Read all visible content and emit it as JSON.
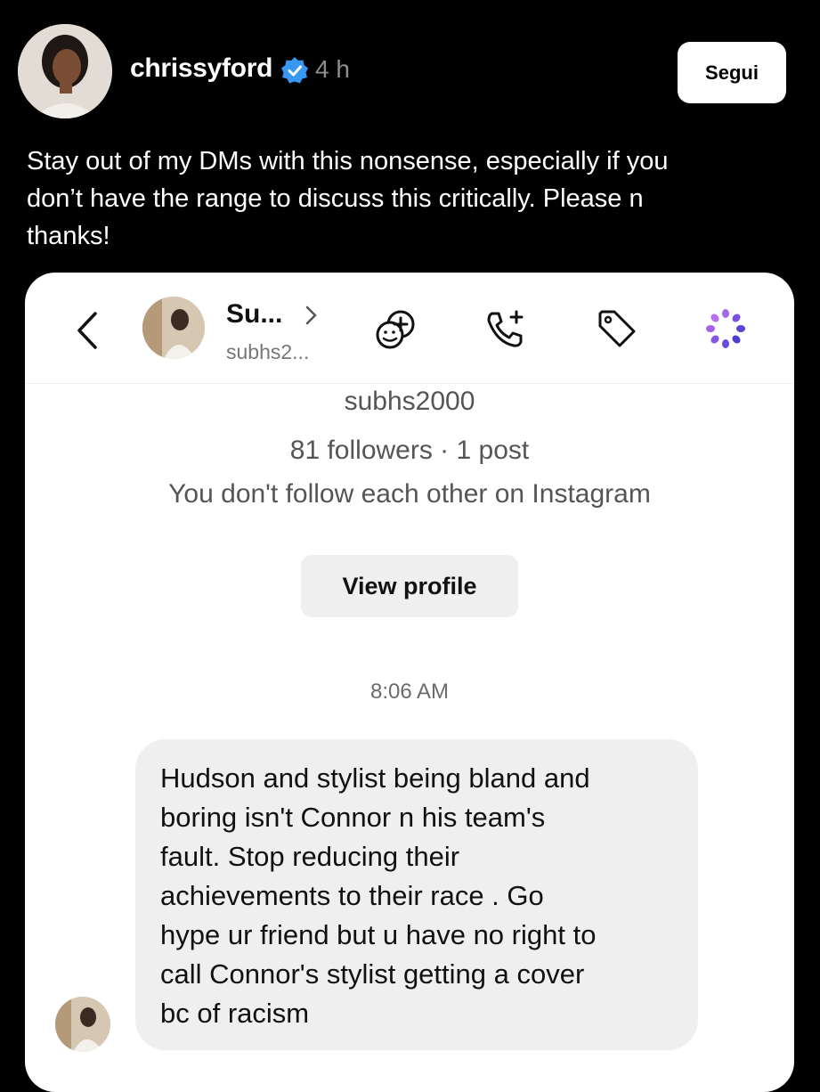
{
  "post": {
    "username": "chrissyford",
    "time": "4 h",
    "follow_label": "Segui",
    "caption_lines": [
      "Stay out of my DMs with this nonsense, especially if you",
      "don’t have the range to discuss this critically. Please n",
      "thanks!"
    ]
  },
  "dm": {
    "header": {
      "name": "Su...",
      "handle": "subhs2..."
    },
    "profile": {
      "username": "subhs2000",
      "stats": "81 followers · 1 post",
      "follow_note": "You don't follow each other on Instagram",
      "view_profile_label": "View profile"
    },
    "timestamp": "8:06 AM",
    "message_lines": [
      "Hudson and stylist being bland and",
      "boring isn't Connor n his team's",
      "fault. Stop reducing their",
      "achievements to their race . Go",
      "hype ur friend but u have no right to",
      "call Connor's stylist getting a cover",
      "bc of racism"
    ]
  },
  "colors": {
    "background": "#000000",
    "verified": "#3897f0",
    "ai_icon": "#7b4fe0",
    "card": "#ffffff",
    "bubble": "#efefef"
  },
  "icons": [
    "verified-badge-icon",
    "back-arrow-icon",
    "chevron-right-icon",
    "add-reaction-icon",
    "call-add-icon",
    "tag-icon",
    "ai-sparkle-icon"
  ]
}
